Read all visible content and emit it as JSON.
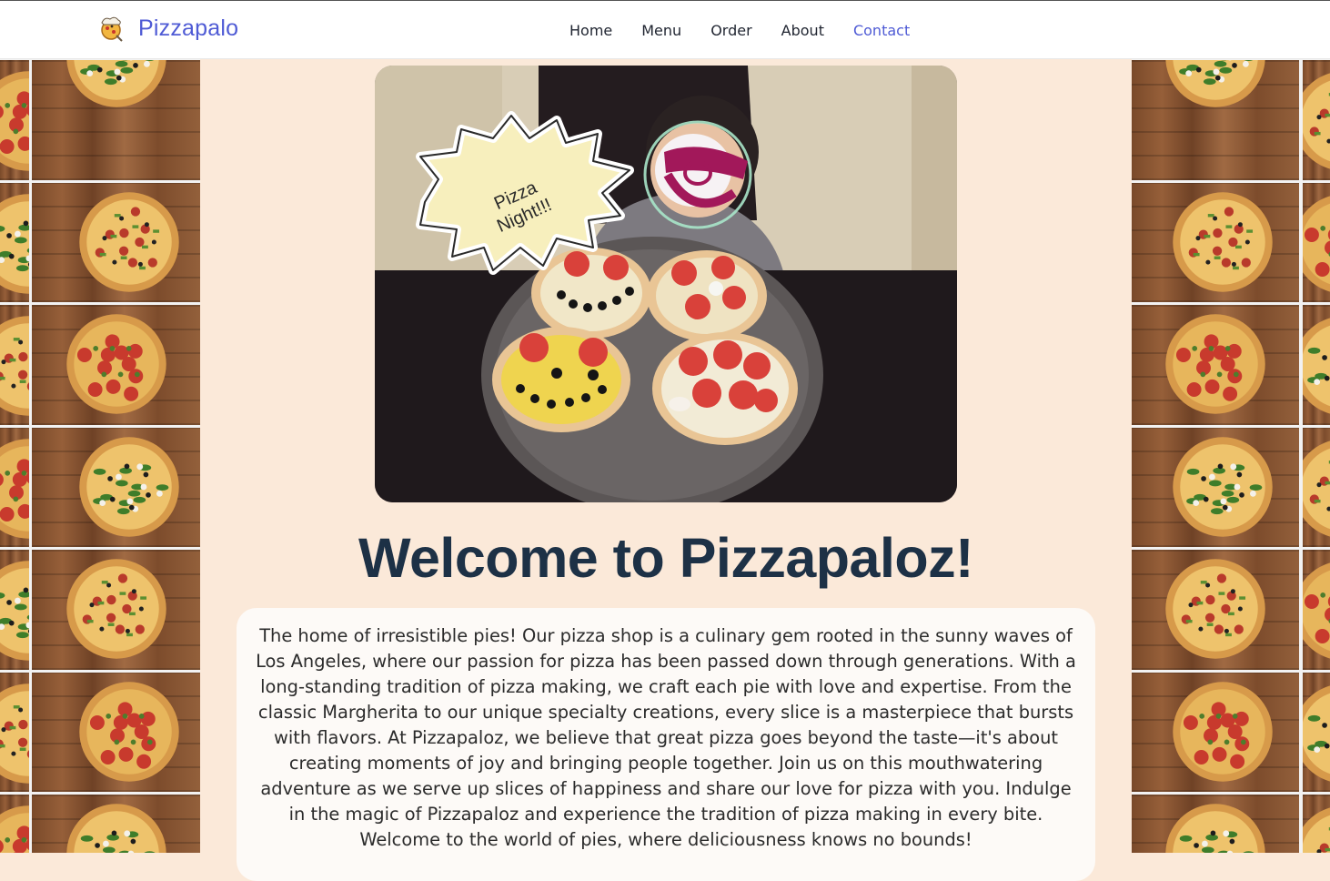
{
  "brand": {
    "name": "Pizzapalo",
    "logo_icon": "pizza-chef-icon"
  },
  "nav": {
    "items": [
      {
        "label": "Home",
        "active": false
      },
      {
        "label": "Menu",
        "active": false
      },
      {
        "label": "Order",
        "active": false
      },
      {
        "label": "About",
        "active": false
      },
      {
        "label": "Contact",
        "active": true
      }
    ]
  },
  "hero": {
    "bubble_line1": "Pizza",
    "bubble_line2": "Night!!!"
  },
  "welcome": {
    "title": "Welcome to Pizzapaloz!"
  },
  "intro": {
    "text": "The home of irresistible pies! Our pizza shop is a culinary gem rooted in the sunny waves of Los Angeles, where our passion for pizza has been passed down through generations. With a long-standing tradition of pizza making, we craft each pie with love and expertise. From the classic Margherita to our unique specialty creations, every slice is a masterpiece that bursts with flavors. At Pizzapaloz, we believe that great pizza goes beyond the taste—it's about creating moments of joy and bringing people together. Join us on this mouthwatering adventure as we serve up slices of happiness and share our love for pizza with you. Indulge in the magic of Pizzapaloz and experience the tradition of pizza making in every bite. Welcome to the world of pies, where deliciousness knows no bounds!"
  },
  "colors": {
    "accent": "#4f5bd5",
    "heading": "#1d3146",
    "page_background": "#fbe9d9",
    "card_background": "#fdfaf7"
  }
}
